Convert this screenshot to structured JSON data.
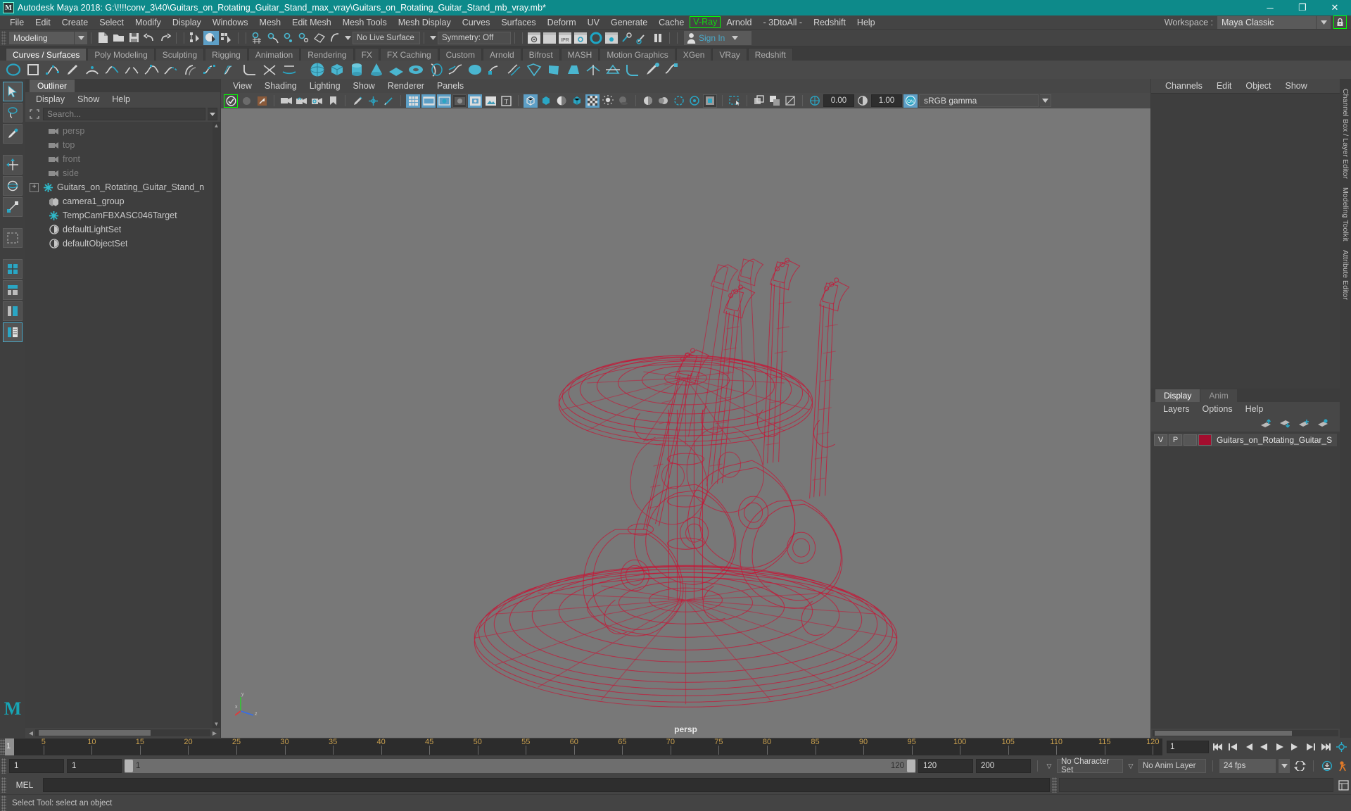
{
  "window": {
    "title": "Autodesk Maya 2018: G:\\!!!!conv_3\\40\\Guitars_on_Rotating_Guitar_Stand_max_vray\\Guitars_on_Rotating_Guitar_Stand_mb_vray.mb*",
    "app_icon": "maya-app-icon",
    "minimize": "─",
    "maximize": "❐",
    "close": "✕",
    "titlebar_color": "#0d8a8a"
  },
  "menubar": {
    "items": [
      {
        "label": "File"
      },
      {
        "label": "Edit"
      },
      {
        "label": "Create"
      },
      {
        "label": "Select"
      },
      {
        "label": "Modify"
      },
      {
        "label": "Display"
      },
      {
        "label": "Windows"
      },
      {
        "label": "Mesh"
      },
      {
        "label": "Edit Mesh"
      },
      {
        "label": "Mesh Tools"
      },
      {
        "label": "Mesh Display"
      },
      {
        "label": "Curves"
      },
      {
        "label": "Surfaces"
      },
      {
        "label": "Deform"
      },
      {
        "label": "UV"
      },
      {
        "label": "Generate"
      },
      {
        "label": "Cache"
      },
      {
        "label": "V-Ray",
        "highlight": "#00ff00"
      },
      {
        "label": "Arnold"
      },
      {
        "label": "- 3DtoAll -"
      },
      {
        "label": "Redshift"
      },
      {
        "label": "Help"
      }
    ],
    "workspace_label": "Workspace :",
    "workspace_value": "Maya Classic",
    "lock_icon": "lock-icon"
  },
  "statusbar": {
    "menuset": "Modeling",
    "live_surface": "No Live Surface",
    "symmetry": "Symmetry: Off",
    "signin": "Sign In",
    "accent": "#4aa8c8"
  },
  "shelf": {
    "tabs": [
      {
        "label": "Curves / Surfaces",
        "active": true
      },
      {
        "label": "Poly Modeling",
        "active": false
      },
      {
        "label": "Sculpting",
        "active": false
      },
      {
        "label": "Rigging",
        "active": false
      },
      {
        "label": "Animation",
        "active": false
      },
      {
        "label": "Rendering",
        "active": false
      },
      {
        "label": "FX",
        "active": false
      },
      {
        "label": "FX Caching",
        "active": false
      },
      {
        "label": "Custom",
        "active": false
      },
      {
        "label": "Arnold",
        "active": false
      },
      {
        "label": "Bifrost",
        "active": false
      },
      {
        "label": "MASH",
        "active": false
      },
      {
        "label": "Motion Graphics",
        "active": false
      },
      {
        "label": "XGen",
        "active": false
      },
      {
        "label": "VRay",
        "active": false
      },
      {
        "label": "Redshift",
        "active": false
      }
    ]
  },
  "outliner": {
    "tab": "Outliner",
    "menus": [
      {
        "label": "Display"
      },
      {
        "label": "Show"
      },
      {
        "label": "Help"
      }
    ],
    "search_placeholder": "Search...",
    "items": [
      {
        "name": "persp",
        "icon": "camera-icon",
        "dim": true,
        "expand": false,
        "indent": 1
      },
      {
        "name": "top",
        "icon": "camera-icon",
        "dim": true,
        "expand": false,
        "indent": 1
      },
      {
        "name": "front",
        "icon": "camera-icon",
        "dim": true,
        "expand": false,
        "indent": 1
      },
      {
        "name": "side",
        "icon": "camera-icon",
        "dim": true,
        "expand": false,
        "indent": 1
      },
      {
        "name": "Guitars_on_Rotating_Guitar_Stand_n",
        "icon": "transform-icon",
        "dim": false,
        "expand": true,
        "indent": 0
      },
      {
        "name": "camera1_group",
        "icon": "group-icon",
        "dim": false,
        "expand": false,
        "indent": 1
      },
      {
        "name": "TempCamFBXASC046Target",
        "icon": "transform-icon",
        "dim": false,
        "expand": false,
        "indent": 1
      },
      {
        "name": "defaultLightSet",
        "icon": "set-icon",
        "dim": false,
        "expand": false,
        "indent": 1
      },
      {
        "name": "defaultObjectSet",
        "icon": "set-icon",
        "dim": false,
        "expand": false,
        "indent": 1
      }
    ]
  },
  "viewport": {
    "menus": [
      {
        "label": "View"
      },
      {
        "label": "Shading"
      },
      {
        "label": "Lighting"
      },
      {
        "label": "Show"
      },
      {
        "label": "Renderer"
      },
      {
        "label": "Panels"
      }
    ],
    "exposure": "0.00",
    "gamma": "1.00",
    "color_management": "sRGB gamma",
    "camera_label": "persp",
    "background_color": "#787878",
    "wireframe_color": "#cc1133",
    "axis": {
      "x": "x",
      "y": "y",
      "z": "z"
    }
  },
  "channelbox": {
    "menus": [
      {
        "label": "Channels"
      },
      {
        "label": "Edit"
      },
      {
        "label": "Object"
      },
      {
        "label": "Show"
      }
    ],
    "side_tabs": [
      "Channel Box / Layer Editor",
      "Modeling Toolkit",
      "Attribute Editor"
    ]
  },
  "layers": {
    "tabs": [
      {
        "label": "Display",
        "active": true
      },
      {
        "label": "Anim",
        "active": false
      }
    ],
    "menus": [
      {
        "label": "Layers"
      },
      {
        "label": "Options"
      },
      {
        "label": "Help"
      }
    ],
    "rows": [
      {
        "visible": "V",
        "playback": "P",
        "state": "",
        "color": "#a30d2e",
        "name": "Guitars_on_Rotating_Guitar_S"
      }
    ]
  },
  "timeslider": {
    "current_frame": "1",
    "ticks": [
      {
        "label": "5",
        "frame": 5
      },
      {
        "label": "10",
        "frame": 10
      },
      {
        "label": "15",
        "frame": 15
      },
      {
        "label": "20",
        "frame": 20
      },
      {
        "label": "25",
        "frame": 25
      },
      {
        "label": "30",
        "frame": 30
      },
      {
        "label": "35",
        "frame": 35
      },
      {
        "label": "40",
        "frame": 40
      },
      {
        "label": "45",
        "frame": 45
      },
      {
        "label": "50",
        "frame": 50
      },
      {
        "label": "55",
        "frame": 55
      },
      {
        "label": "60",
        "frame": 60
      },
      {
        "label": "65",
        "frame": 65
      },
      {
        "label": "70",
        "frame": 70
      },
      {
        "label": "75",
        "frame": 75
      },
      {
        "label": "80",
        "frame": 80
      },
      {
        "label": "85",
        "frame": 85
      },
      {
        "label": "90",
        "frame": 90
      },
      {
        "label": "95",
        "frame": 95
      },
      {
        "label": "100",
        "frame": 100
      },
      {
        "label": "105",
        "frame": 105
      },
      {
        "label": "110",
        "frame": 110
      },
      {
        "label": "115",
        "frame": 115
      },
      {
        "label": "120",
        "frame": 120
      }
    ],
    "range_min": 1,
    "range_max": 120,
    "field_value": "1",
    "playback_buttons": [
      "go-to-start",
      "step-back-key",
      "step-back-frame",
      "play-backwards",
      "play-forwards",
      "step-forward-frame",
      "step-forward-key",
      "go-to-end"
    ]
  },
  "rangeslider": {
    "anim_start": "1",
    "range_start": "1",
    "bar_start": "1",
    "bar_end": "120",
    "range_end": "120",
    "anim_end": "200",
    "character_set": "No Character Set",
    "anim_layer": "No Anim Layer",
    "fps": "24 fps"
  },
  "commandline": {
    "language": "MEL",
    "input_value": "",
    "output_value": ""
  },
  "helpline": {
    "message": "Select Tool: select an object"
  }
}
